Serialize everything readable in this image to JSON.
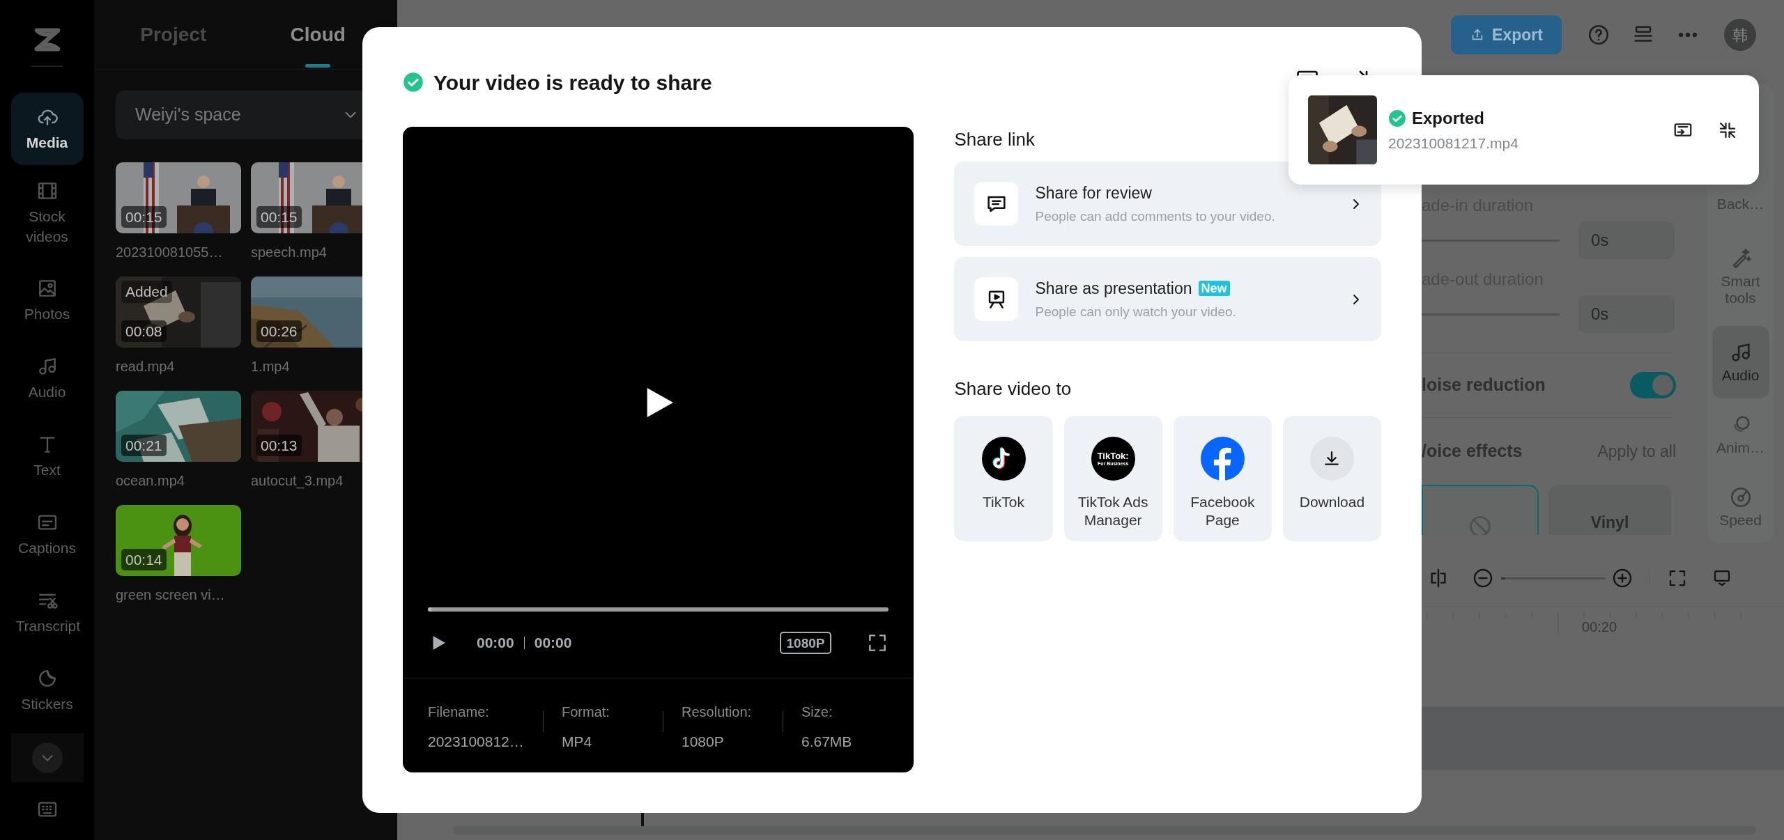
{
  "nav_rail": {
    "items": [
      {
        "label": "Media",
        "selected": true
      },
      {
        "label": "Stock videos",
        "selected": false
      },
      {
        "label": "Photos",
        "selected": false
      },
      {
        "label": "Audio",
        "selected": false
      },
      {
        "label": "Text",
        "selected": false
      },
      {
        "label": "Captions",
        "selected": false
      },
      {
        "label": "Transcript",
        "selected": false
      },
      {
        "label": "Stickers",
        "selected": false
      }
    ]
  },
  "media_panel": {
    "tabs": [
      {
        "label": "Project",
        "selected": false
      },
      {
        "label": "Cloud",
        "selected": true
      }
    ],
    "space_selector": "Weiyi's space",
    "media": [
      {
        "name": "202310081055…",
        "duration": "00:15"
      },
      {
        "name": "speech.mp4",
        "duration": "00:15"
      },
      {
        "name": "read.mp4",
        "duration": "00:08",
        "badge": "Added"
      },
      {
        "name": "1.mp4",
        "duration": "00:26"
      },
      {
        "name": "ocean.mp4",
        "duration": "00:21"
      },
      {
        "name": "autocut_3.mp4",
        "duration": "00:13"
      },
      {
        "name": "green screen vi…",
        "duration": "00:14"
      }
    ]
  },
  "top_bar": {
    "export_button": "Export",
    "avatar": "韩"
  },
  "properties_panel": {
    "fade_in": {
      "label": "ade-in duration",
      "value": "0s"
    },
    "fade_out": {
      "label": "ade-out duration",
      "value": "0s"
    },
    "noise_reduction": {
      "label": "loise reduction",
      "on": true
    },
    "voice_effects": {
      "label": "/oice effects",
      "apply_all": "Apply to all",
      "options": [
        {
          "kind": "none",
          "selected": true
        },
        {
          "kind": "effect",
          "label": "Vinyl",
          "selected": false
        }
      ]
    }
  },
  "right_rail": {
    "items": [
      {
        "label": "Back…",
        "selected": false
      },
      {
        "label": "Smart tools",
        "selected": false
      },
      {
        "label": "Audio",
        "selected": true
      },
      {
        "label": "Anim…",
        "selected": false
      },
      {
        "label": "Speed",
        "selected": false
      }
    ]
  },
  "timeline": {
    "zoom_slider": {
      "level": 0.04
    },
    "ruler_label": "00:20"
  },
  "dialog": {
    "title": "Your video is ready to share",
    "player": {
      "progress": {
        "level": 0
      },
      "current_time": "00:00",
      "total_time": "00:00",
      "quality": "1080P",
      "info": [
        {
          "label": "Filename:",
          "value": "2023100812…"
        },
        {
          "label": "Format:",
          "value": "MP4"
        },
        {
          "label": "Resolution:",
          "value": "1080P"
        },
        {
          "label": "Size:",
          "value": "6.67MB"
        }
      ]
    },
    "share_link": {
      "heading": "Share link",
      "options": [
        {
          "kind": "review",
          "title": "Share for review",
          "description": "People can add comments to your video."
        },
        {
          "kind": "presentation",
          "title": "Share as presentation",
          "badge": "New",
          "description": "People can only watch your video."
        }
      ]
    },
    "share_to": {
      "heading": "Share video to",
      "targets": [
        {
          "kind": "tiktok",
          "label": "TikTok"
        },
        {
          "kind": "tiktok_ads",
          "label": "TikTok Ads Manager",
          "logo_lines": [
            "TikTok:",
            "For Business"
          ]
        },
        {
          "kind": "facebook",
          "label": "Facebook Page"
        },
        {
          "kind": "download",
          "label": "Download"
        }
      ]
    }
  },
  "export_toast": {
    "title": "Exported",
    "filename": "202310081217.mp4"
  }
}
